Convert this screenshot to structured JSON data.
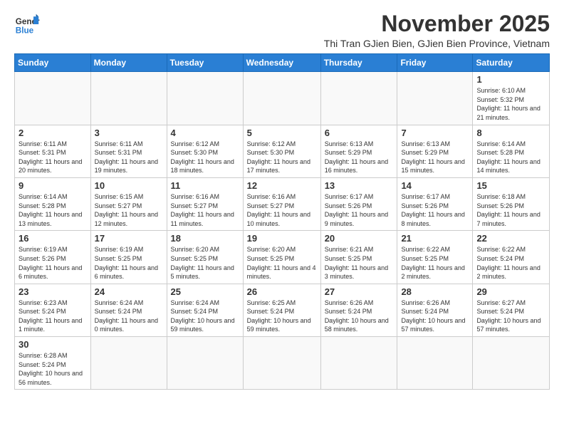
{
  "logo": {
    "line1": "General",
    "line2": "Blue"
  },
  "title": "November 2025",
  "subtitle": "Thi Tran GJien Bien, GJien Bien Province, Vietnam",
  "days_of_week": [
    "Sunday",
    "Monday",
    "Tuesday",
    "Wednesday",
    "Thursday",
    "Friday",
    "Saturday"
  ],
  "weeks": [
    [
      {
        "day": "",
        "info": ""
      },
      {
        "day": "",
        "info": ""
      },
      {
        "day": "",
        "info": ""
      },
      {
        "day": "",
        "info": ""
      },
      {
        "day": "",
        "info": ""
      },
      {
        "day": "",
        "info": ""
      },
      {
        "day": "1",
        "info": "Sunrise: 6:10 AM\nSunset: 5:32 PM\nDaylight: 11 hours and 21 minutes."
      }
    ],
    [
      {
        "day": "2",
        "info": "Sunrise: 6:11 AM\nSunset: 5:31 PM\nDaylight: 11 hours and 20 minutes."
      },
      {
        "day": "3",
        "info": "Sunrise: 6:11 AM\nSunset: 5:31 PM\nDaylight: 11 hours and 19 minutes."
      },
      {
        "day": "4",
        "info": "Sunrise: 6:12 AM\nSunset: 5:30 PM\nDaylight: 11 hours and 18 minutes."
      },
      {
        "day": "5",
        "info": "Sunrise: 6:12 AM\nSunset: 5:30 PM\nDaylight: 11 hours and 17 minutes."
      },
      {
        "day": "6",
        "info": "Sunrise: 6:13 AM\nSunset: 5:29 PM\nDaylight: 11 hours and 16 minutes."
      },
      {
        "day": "7",
        "info": "Sunrise: 6:13 AM\nSunset: 5:29 PM\nDaylight: 11 hours and 15 minutes."
      },
      {
        "day": "8",
        "info": "Sunrise: 6:14 AM\nSunset: 5:28 PM\nDaylight: 11 hours and 14 minutes."
      }
    ],
    [
      {
        "day": "9",
        "info": "Sunrise: 6:14 AM\nSunset: 5:28 PM\nDaylight: 11 hours and 13 minutes."
      },
      {
        "day": "10",
        "info": "Sunrise: 6:15 AM\nSunset: 5:27 PM\nDaylight: 11 hours and 12 minutes."
      },
      {
        "day": "11",
        "info": "Sunrise: 6:16 AM\nSunset: 5:27 PM\nDaylight: 11 hours and 11 minutes."
      },
      {
        "day": "12",
        "info": "Sunrise: 6:16 AM\nSunset: 5:27 PM\nDaylight: 11 hours and 10 minutes."
      },
      {
        "day": "13",
        "info": "Sunrise: 6:17 AM\nSunset: 5:26 PM\nDaylight: 11 hours and 9 minutes."
      },
      {
        "day": "14",
        "info": "Sunrise: 6:17 AM\nSunset: 5:26 PM\nDaylight: 11 hours and 8 minutes."
      },
      {
        "day": "15",
        "info": "Sunrise: 6:18 AM\nSunset: 5:26 PM\nDaylight: 11 hours and 7 minutes."
      }
    ],
    [
      {
        "day": "16",
        "info": "Sunrise: 6:19 AM\nSunset: 5:26 PM\nDaylight: 11 hours and 6 minutes."
      },
      {
        "day": "17",
        "info": "Sunrise: 6:19 AM\nSunset: 5:25 PM\nDaylight: 11 hours and 6 minutes."
      },
      {
        "day": "18",
        "info": "Sunrise: 6:20 AM\nSunset: 5:25 PM\nDaylight: 11 hours and 5 minutes."
      },
      {
        "day": "19",
        "info": "Sunrise: 6:20 AM\nSunset: 5:25 PM\nDaylight: 11 hours and 4 minutes."
      },
      {
        "day": "20",
        "info": "Sunrise: 6:21 AM\nSunset: 5:25 PM\nDaylight: 11 hours and 3 minutes."
      },
      {
        "day": "21",
        "info": "Sunrise: 6:22 AM\nSunset: 5:25 PM\nDaylight: 11 hours and 2 minutes."
      },
      {
        "day": "22",
        "info": "Sunrise: 6:22 AM\nSunset: 5:24 PM\nDaylight: 11 hours and 2 minutes."
      }
    ],
    [
      {
        "day": "23",
        "info": "Sunrise: 6:23 AM\nSunset: 5:24 PM\nDaylight: 11 hours and 1 minute."
      },
      {
        "day": "24",
        "info": "Sunrise: 6:24 AM\nSunset: 5:24 PM\nDaylight: 11 hours and 0 minutes."
      },
      {
        "day": "25",
        "info": "Sunrise: 6:24 AM\nSunset: 5:24 PM\nDaylight: 10 hours and 59 minutes."
      },
      {
        "day": "26",
        "info": "Sunrise: 6:25 AM\nSunset: 5:24 PM\nDaylight: 10 hours and 59 minutes."
      },
      {
        "day": "27",
        "info": "Sunrise: 6:26 AM\nSunset: 5:24 PM\nDaylight: 10 hours and 58 minutes."
      },
      {
        "day": "28",
        "info": "Sunrise: 6:26 AM\nSunset: 5:24 PM\nDaylight: 10 hours and 57 minutes."
      },
      {
        "day": "29",
        "info": "Sunrise: 6:27 AM\nSunset: 5:24 PM\nDaylight: 10 hours and 57 minutes."
      }
    ],
    [
      {
        "day": "30",
        "info": "Sunrise: 6:28 AM\nSunset: 5:24 PM\nDaylight: 10 hours and 56 minutes."
      },
      {
        "day": "",
        "info": ""
      },
      {
        "day": "",
        "info": ""
      },
      {
        "day": "",
        "info": ""
      },
      {
        "day": "",
        "info": ""
      },
      {
        "day": "",
        "info": ""
      },
      {
        "day": "",
        "info": ""
      }
    ]
  ]
}
